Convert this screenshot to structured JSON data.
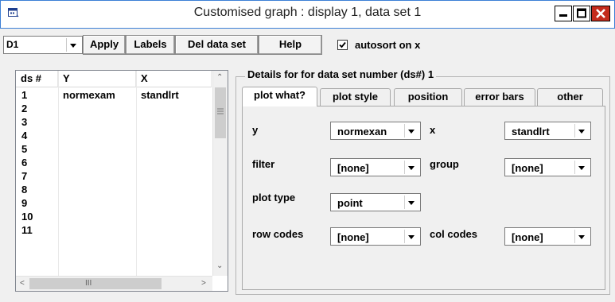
{
  "window": {
    "title": "Customised graph : display 1, data set 1"
  },
  "toolbar": {
    "display_value": "D1",
    "apply": "Apply",
    "labels": "Labels",
    "del_data_set": "Del data set",
    "help": "Help",
    "autosort_label": "autosort on x",
    "autosort_checked": true
  },
  "list": {
    "headers": {
      "ds": "ds #",
      "y": "Y",
      "x": "X"
    },
    "rows": [
      {
        "ds": "1",
        "y": "normexam",
        "x": "standlrt"
      },
      {
        "ds": "2",
        "y": "",
        "x": ""
      },
      {
        "ds": "3",
        "y": "",
        "x": ""
      },
      {
        "ds": "4",
        "y": "",
        "x": ""
      },
      {
        "ds": "5",
        "y": "",
        "x": ""
      },
      {
        "ds": "6",
        "y": "",
        "x": ""
      },
      {
        "ds": "7",
        "y": "",
        "x": ""
      },
      {
        "ds": "8",
        "y": "",
        "x": ""
      },
      {
        "ds": "9",
        "y": "",
        "x": ""
      },
      {
        "ds": "10",
        "y": "",
        "x": ""
      },
      {
        "ds": "11",
        "y": "",
        "x": ""
      }
    ],
    "hscroll_glyph": "III"
  },
  "details": {
    "group_label": "Details for for data set number (ds#) 1",
    "tabs": [
      "plot what?",
      "plot style",
      "position",
      "error bars",
      "other"
    ],
    "active_tab": "plot what?",
    "fields": {
      "y_label": "y",
      "y_value": "normexan",
      "x_label": "x",
      "x_value": "standlrt",
      "filter_label": "filter",
      "filter_value": "[none]",
      "group_label": "group",
      "group_value": "[none]",
      "plot_type_label": "plot type",
      "plot_type_value": "point",
      "row_codes_label": "row codes",
      "row_codes_value": "[none]",
      "col_codes_label": "col codes",
      "col_codes_value": "[none]"
    }
  },
  "colors": {
    "close_button": "#c42b1c",
    "window_border": "#3c7fd6",
    "background": "#f0f0f0"
  }
}
